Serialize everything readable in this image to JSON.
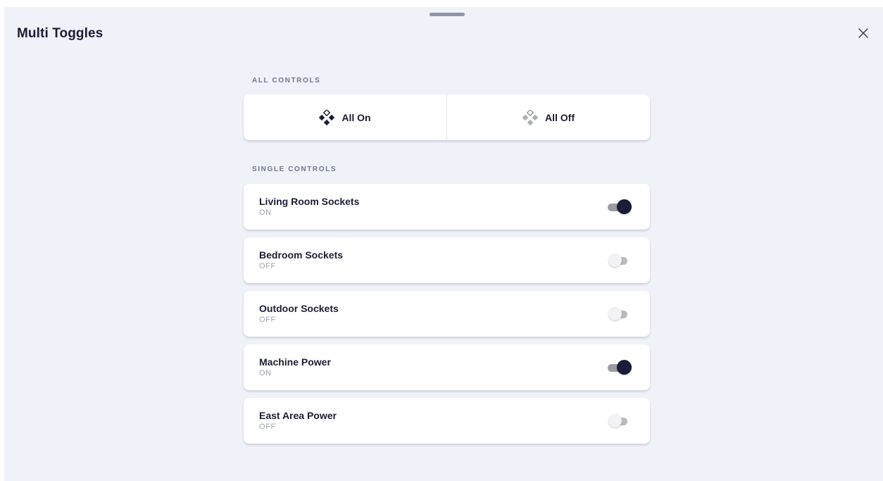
{
  "sheet": {
    "title": "Multi Toggles",
    "close_icon": "close-icon"
  },
  "all_controls": {
    "label": "ALL CONTROLS",
    "all_on_label": "All On",
    "all_off_label": "All Off",
    "icon": "diamond-cluster-icon"
  },
  "single_controls": {
    "label": "SINGLE CONTROLS",
    "devices": [
      {
        "name": "Living Room Sockets",
        "state": "ON",
        "on": true
      },
      {
        "name": "Bedroom Sockets",
        "state": "OFF",
        "on": false
      },
      {
        "name": "Outdoor Sockets",
        "state": "OFF",
        "on": false
      },
      {
        "name": "Machine Power",
        "state": "ON",
        "on": true
      },
      {
        "name": "East Area Power",
        "state": "OFF",
        "on": false
      }
    ]
  },
  "colors": {
    "background": "#eff2f9",
    "card": "#ffffff",
    "text_primary": "#1c1d33",
    "text_muted": "#9ea1b0",
    "toggle_on_knob": "#1b1c3a",
    "toggle_on_track": "#9b9ba3",
    "toggle_off_knob": "#f2f2f4",
    "toggle_off_track": "#b9b9c0"
  }
}
